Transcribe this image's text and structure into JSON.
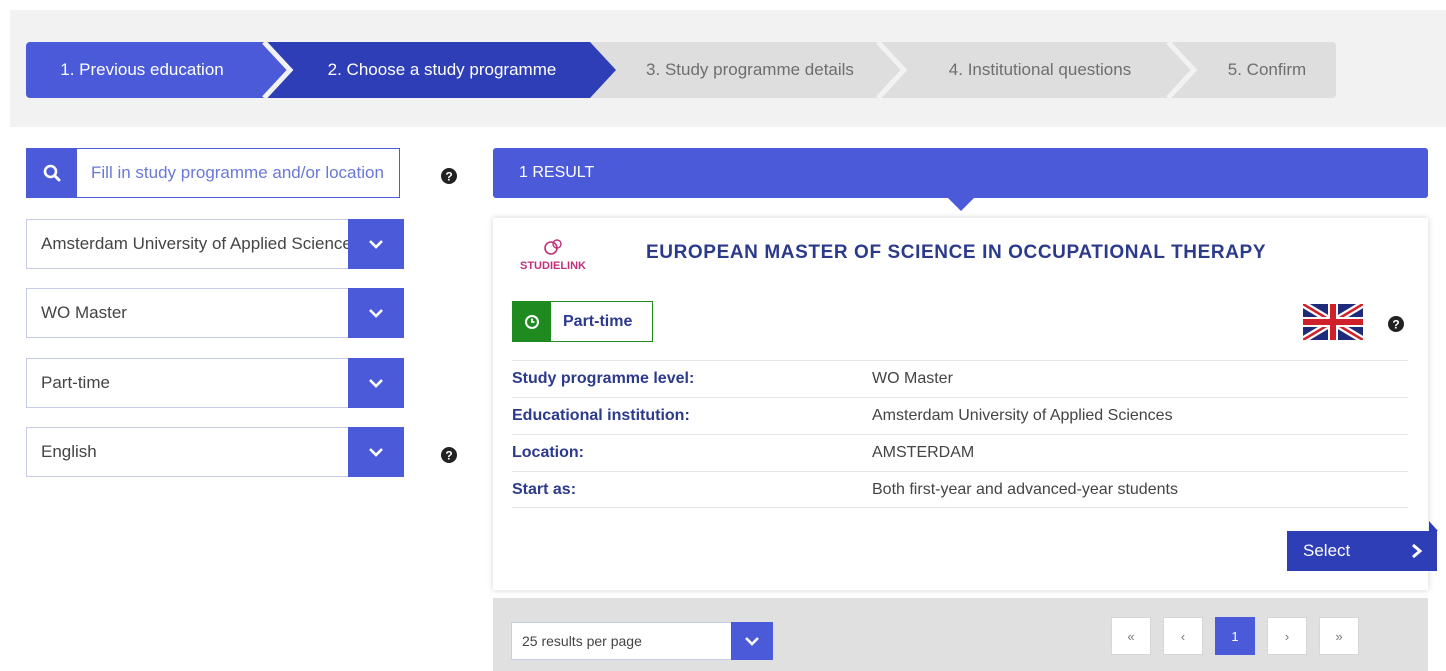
{
  "stepper": {
    "steps": [
      {
        "label": "1. Previous education",
        "state": "done"
      },
      {
        "label": "2. Choose a study programme",
        "state": "active"
      },
      {
        "label": "3. Study programme details",
        "state": "todo"
      },
      {
        "label": "4. Institutional questions",
        "state": "todo"
      },
      {
        "label": "5. Confirm",
        "state": "todo"
      }
    ]
  },
  "filters": {
    "search": {
      "placeholder": "Fill in study programme and/or location",
      "icon": "search-icon"
    },
    "institution": {
      "value": "Amsterdam University of Applied Sciences"
    },
    "level": {
      "value": "WO Master"
    },
    "form": {
      "value": "Part-time"
    },
    "language": {
      "value": "English"
    }
  },
  "results": {
    "count_label": "1 RESULT",
    "items": [
      {
        "logo_text": "STUDIELINK",
        "title": "EUROPEAN MASTER OF SCIENCE IN OCCUPATIONAL THERAPY",
        "badge": "Part-time",
        "language_flag": "uk-flag-icon",
        "details": [
          {
            "key": "Study programme level:",
            "value": "WO Master"
          },
          {
            "key": "Educational institution:",
            "value": "Amsterdam University of Applied Sciences"
          },
          {
            "key": "Location:",
            "value": "AMSTERDAM"
          },
          {
            "key": "Start as:",
            "value": "Both first-year and advanced-year students"
          }
        ],
        "select_label": "Select"
      }
    ]
  },
  "pagination": {
    "per_page": "25 results per page",
    "first": "«",
    "prev": "‹",
    "current": "1",
    "next": "›",
    "last": "»"
  },
  "colors": {
    "primary": "#4a5ad8",
    "primary_dark": "#2d3eb7",
    "title": "#2c3a8c",
    "badge_green": "#1f8a1f",
    "step_inactive": "#dedede"
  }
}
